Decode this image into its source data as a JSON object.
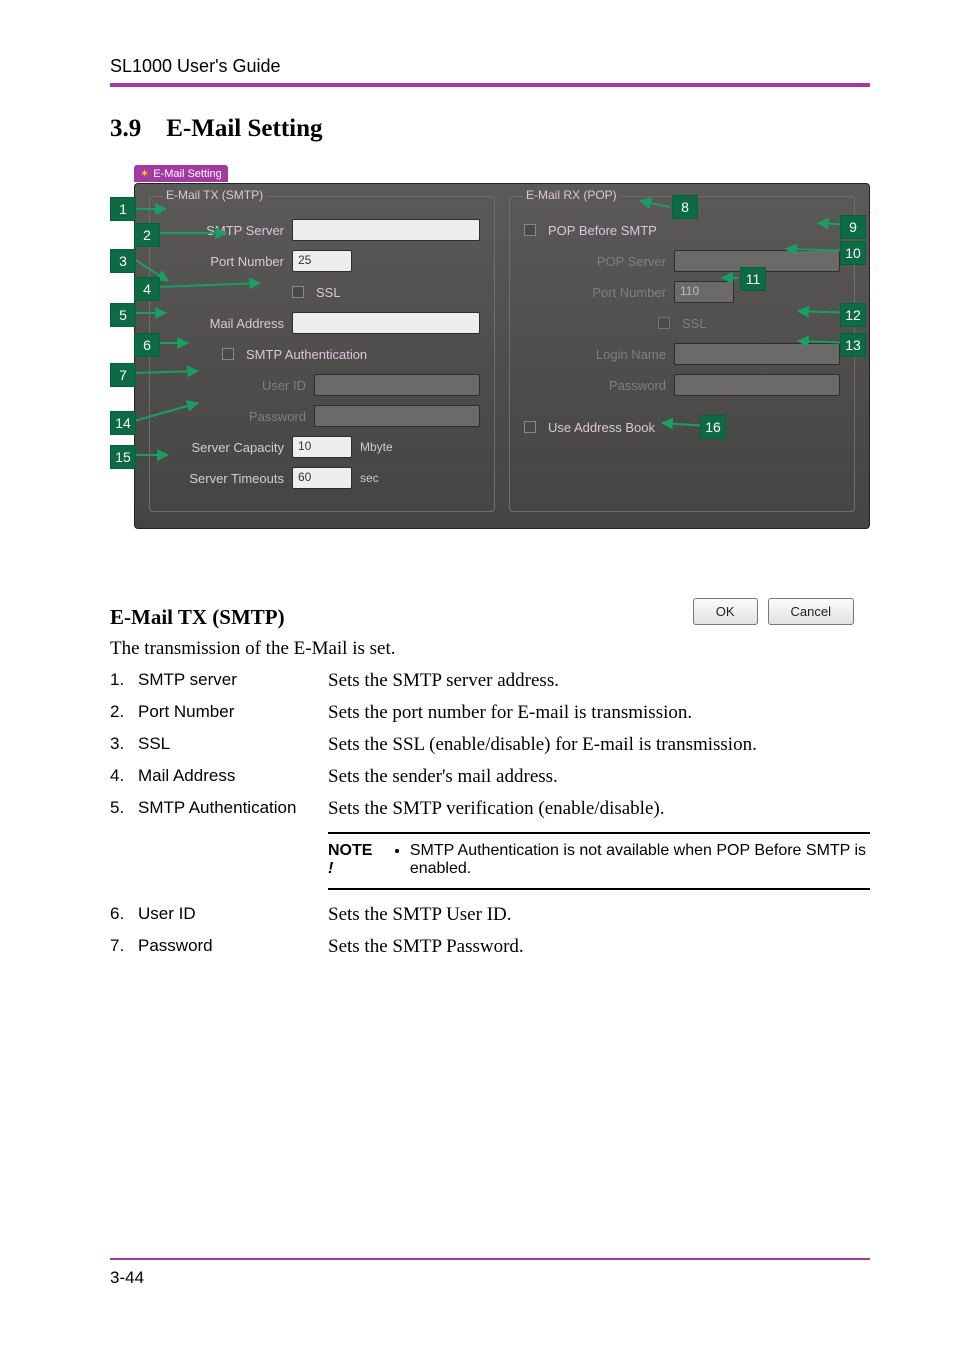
{
  "header": {
    "guide": "SL1000 User's Guide"
  },
  "section": {
    "number": "3.9",
    "title": "E-Mail Setting"
  },
  "screenshot": {
    "window_title": "E-Mail Setting",
    "left_group_title": "E-Mail TX (SMTP)",
    "right_group_title": "E-Mail RX (POP)",
    "left": {
      "smtp_server_label": "SMTP Server",
      "port_number_label": "Port Number",
      "port_number_value": "25",
      "ssl_label": "SSL",
      "mail_address_label": "Mail Address",
      "smtp_auth_label": "SMTP Authentication",
      "user_id_label": "User ID",
      "password_label": "Password",
      "server_capacity_label": "Server Capacity",
      "server_capacity_value": "10",
      "server_capacity_unit": "Mbyte",
      "server_timeouts_label": "Server Timeouts",
      "server_timeouts_value": "60",
      "server_timeouts_unit": "sec"
    },
    "right": {
      "pop_before_smtp_label": "POP Before SMTP",
      "pop_server_label": "POP Server",
      "port_number_label": "Port Number",
      "port_number_value": "110",
      "ssl_label": "SSL",
      "login_name_label": "Login Name",
      "password_label": "Password",
      "use_address_book_label": "Use Address Book"
    },
    "buttons": {
      "ok": "OK",
      "cancel": "Cancel"
    },
    "callouts": {
      "c1": "1",
      "c2": "2",
      "c3": "3",
      "c4": "4",
      "c5": "5",
      "c6": "6",
      "c7": "7",
      "c8": "8",
      "c9": "9",
      "c10": "10",
      "c11": "11",
      "c12": "12",
      "c13": "13",
      "c14": "14",
      "c15": "15",
      "c16": "16"
    }
  },
  "narrative": {
    "h3": "E-Mail TX (SMTP)",
    "intro": "The transmission of the E-Mail is set.",
    "items": [
      {
        "n": "1.",
        "k": "SMTP server",
        "d": "Sets the SMTP server address."
      },
      {
        "n": "2.",
        "k": "Port Number",
        "d": "Sets the port number for E-mail is transmission."
      },
      {
        "n": "3.",
        "k": "SSL",
        "d": "Sets the SSL (enable/disable) for E-mail is transmission."
      },
      {
        "n": "4.",
        "k": "Mail Address",
        "d": "Sets the sender's mail address."
      },
      {
        "n": "5.",
        "k": "SMTP Authentication",
        "d": "Sets the SMTP verification (enable/disable)."
      }
    ],
    "note_label": "NOTE !",
    "note_bullet": "SMTP Authentication is not available when POP Before SMTP is enabled.",
    "items2": [
      {
        "n": "6.",
        "k": "User ID",
        "d": "Sets the SMTP User ID."
      },
      {
        "n": "7.",
        "k": "Password",
        "d": "Sets the SMTP Password."
      }
    ]
  },
  "footer": {
    "page": "3-44"
  }
}
